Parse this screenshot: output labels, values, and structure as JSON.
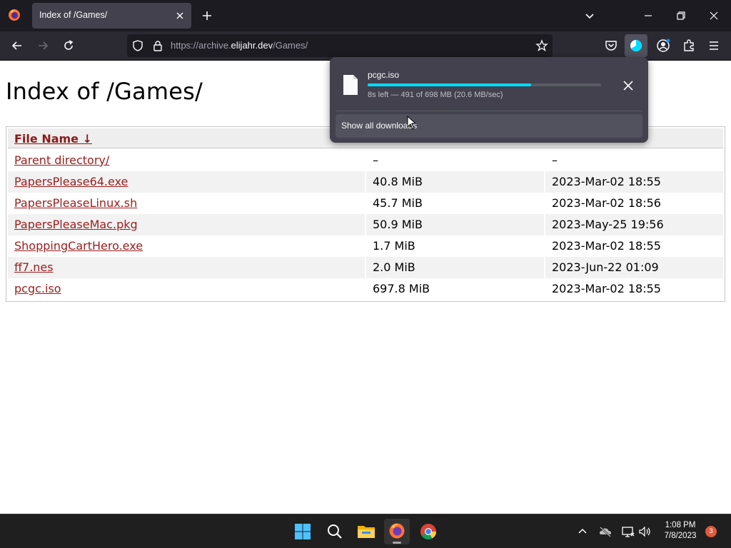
{
  "browser": {
    "tab": {
      "title": "Index of /Games/"
    },
    "url": {
      "scheme_path_prefix": "https://archive.",
      "host": "elijahr.dev",
      "path": "/Games/"
    }
  },
  "page": {
    "heading": "Index of /Games/",
    "table": {
      "headers": {
        "name": "File Name  ↓"
      },
      "rows": [
        {
          "name": "Parent directory/",
          "size": "–",
          "date": "–"
        },
        {
          "name": "PapersPlease64.exe",
          "size": "40.8 MiB",
          "date": "2023-Mar-02 18:55"
        },
        {
          "name": "PapersPleaseLinux.sh",
          "size": "45.7 MiB",
          "date": "2023-Mar-02 18:56"
        },
        {
          "name": "PapersPleaseMac.pkg",
          "size": "50.9 MiB",
          "date": "2023-May-25 19:56"
        },
        {
          "name": "ShoppingCartHero.exe",
          "size": "1.7 MiB",
          "date": "2023-Mar-02 18:55"
        },
        {
          "name": "ff7.nes",
          "size": "2.0 MiB",
          "date": "2023-Jun-22 01:09"
        },
        {
          "name": "pcgc.iso",
          "size": "697.8 MiB",
          "date": "2023-Mar-02 18:55"
        }
      ]
    }
  },
  "downloads": {
    "item": {
      "filename": "pcgc.iso",
      "status": "8s left — 491 of 698 MB (20.6 MB/sec)",
      "progress_percent": 70
    },
    "show_all_label": "Show all downloads"
  },
  "taskbar": {
    "time": "1:08 PM",
    "date": "7/8/2023",
    "notification_count": "3"
  },
  "colors": {
    "link": "#9a1d1d",
    "progress": "#00ddff",
    "tab_active": "#42414d",
    "toolbar": "#2b2a33"
  }
}
